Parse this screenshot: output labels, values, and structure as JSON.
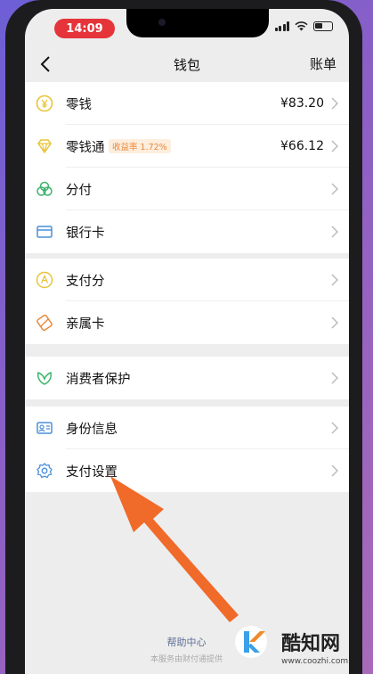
{
  "status_bar": {
    "time": "14:09"
  },
  "nav": {
    "title": "钱包",
    "right": "账单"
  },
  "groups": [
    {
      "items": [
        {
          "label": "零钱",
          "value": "¥83.20"
        },
        {
          "label": "零钱通",
          "badge": "收益率 1.72%",
          "value": "¥66.12"
        },
        {
          "label": "分付"
        },
        {
          "label": "银行卡"
        }
      ]
    },
    {
      "items": [
        {
          "label": "支付分"
        },
        {
          "label": "亲属卡"
        }
      ]
    },
    {
      "items": [
        {
          "label": "消费者保护"
        }
      ]
    },
    {
      "items": [
        {
          "label": "身份信息"
        },
        {
          "label": "支付设置"
        }
      ]
    }
  ],
  "footer": {
    "help": "帮助中心",
    "note": "本服务由财付通提供"
  },
  "watermark": {
    "name": "酷知网",
    "url": "www.coozhi.com"
  },
  "colors": {
    "accent_arrow": "#f06a2a",
    "time_pill": "#e5343a"
  }
}
